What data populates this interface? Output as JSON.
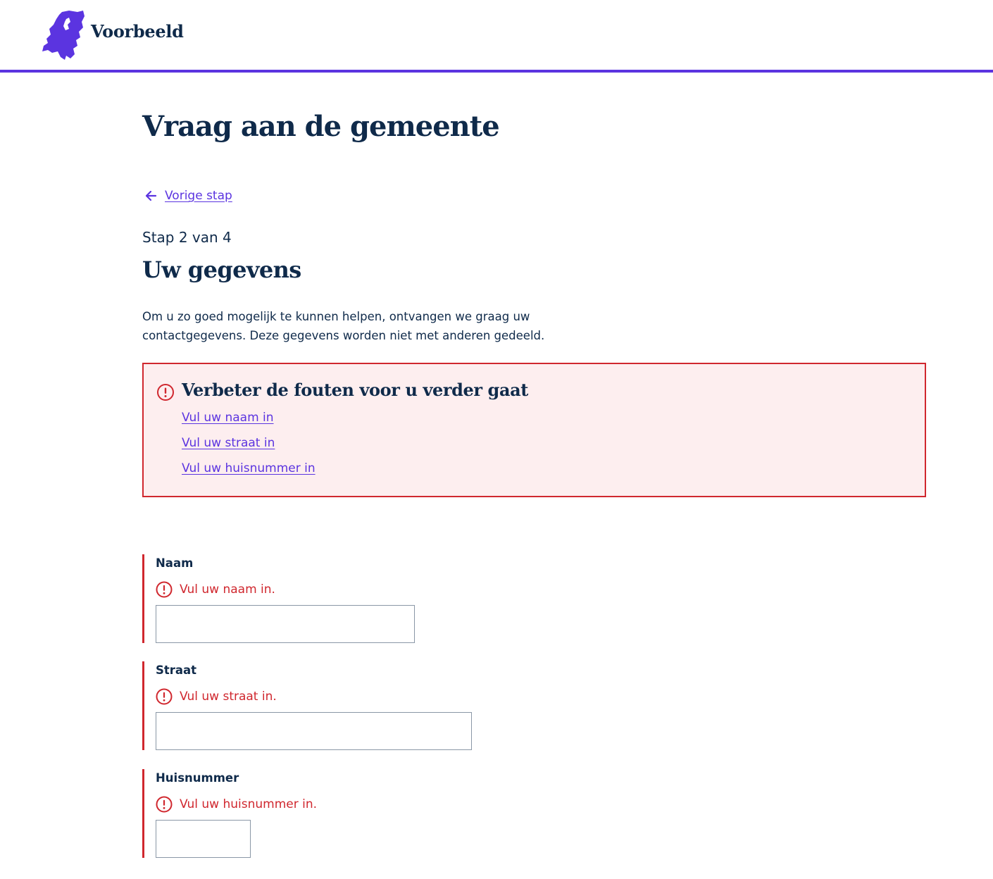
{
  "header": {
    "logo_text": "Voorbeeld",
    "logo_icon": "netherlands-map-icon"
  },
  "page": {
    "title": "Vraag aan de gemeente"
  },
  "nav": {
    "back_label": "Vorige stap",
    "back_icon": "arrow-left-icon"
  },
  "step": {
    "indicator": "Stap 2 van 4",
    "title": "Uw gegevens"
  },
  "intro": {
    "text": "Om u zo goed mogelijk te kunnen helpen, ontvangen we graag uw contactgegevens. Deze gegevens worden niet met anderen gedeeld."
  },
  "error_summary": {
    "icon": "alert-circle-icon",
    "title": "Verbeter de fouten voor u verder gaat",
    "links": [
      "Vul uw naam in",
      "Vul uw straat in",
      "Vul uw huisnummer in"
    ]
  },
  "fields": [
    {
      "label": "Naam",
      "error": "Vul uw naam in.",
      "value": ""
    },
    {
      "label": "Straat",
      "error": "Vul uw straat in.",
      "value": ""
    },
    {
      "label": "Huisnummer",
      "error": "Vul uw huisnummer in.",
      "value": ""
    }
  ],
  "colors": {
    "accent": "#5b34e0",
    "text": "#0f2a4a",
    "error": "#d0272e",
    "error_bg": "#fdeeef"
  }
}
